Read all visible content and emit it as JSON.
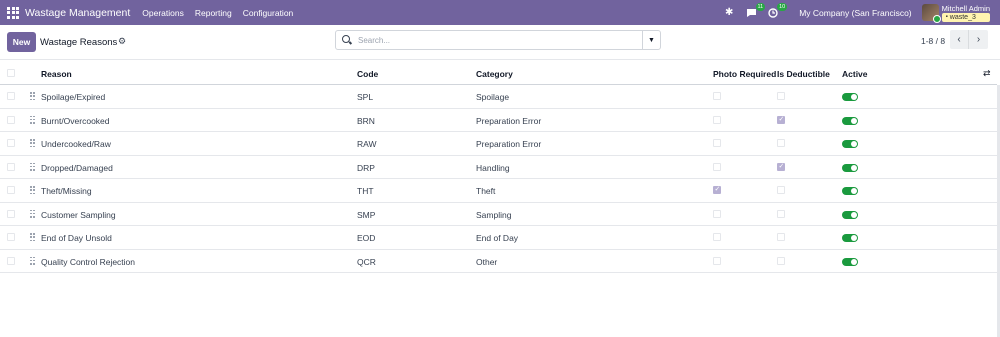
{
  "navbar": {
    "app_title": "Wastage Management",
    "menu": [
      "Operations",
      "Reporting",
      "Configuration"
    ],
    "messages_count": "11",
    "activities_count": "10",
    "company": "My Company (San Francisco)",
    "user_name": "Mitchell Admin",
    "database": "waste_3",
    "color": "#71639e"
  },
  "control": {
    "new_label": "New",
    "title": "Wastage Reasons",
    "search_placeholder": "Search...",
    "pager_value": "1-8 / 8"
  },
  "table": {
    "headers": {
      "reason": "Reason",
      "code": "Code",
      "category": "Category",
      "photo_required": "Photo Required",
      "is_deductible": "Is Deductible",
      "active": "Active"
    },
    "rows": [
      {
        "reason": "Spoilage/Expired",
        "code": "SPL",
        "category": "Spoilage",
        "photo_required": false,
        "is_deductible": false,
        "active": true
      },
      {
        "reason": "Burnt/Overcooked",
        "code": "BRN",
        "category": "Preparation Error",
        "photo_required": false,
        "is_deductible": true,
        "active": true
      },
      {
        "reason": "Undercooked/Raw",
        "code": "RAW",
        "category": "Preparation Error",
        "photo_required": false,
        "is_deductible": false,
        "active": true
      },
      {
        "reason": "Dropped/Damaged",
        "code": "DRP",
        "category": "Handling",
        "photo_required": false,
        "is_deductible": true,
        "active": true
      },
      {
        "reason": "Theft/Missing",
        "code": "THT",
        "category": "Theft",
        "photo_required": true,
        "is_deductible": false,
        "active": true
      },
      {
        "reason": "Customer Sampling",
        "code": "SMP",
        "category": "Sampling",
        "photo_required": false,
        "is_deductible": false,
        "active": true
      },
      {
        "reason": "End of Day Unsold",
        "code": "EOD",
        "category": "End of Day",
        "photo_required": false,
        "is_deductible": false,
        "active": true
      },
      {
        "reason": "Quality Control Rejection",
        "code": "QCR",
        "category": "Other",
        "photo_required": false,
        "is_deductible": false,
        "active": true
      }
    ]
  }
}
